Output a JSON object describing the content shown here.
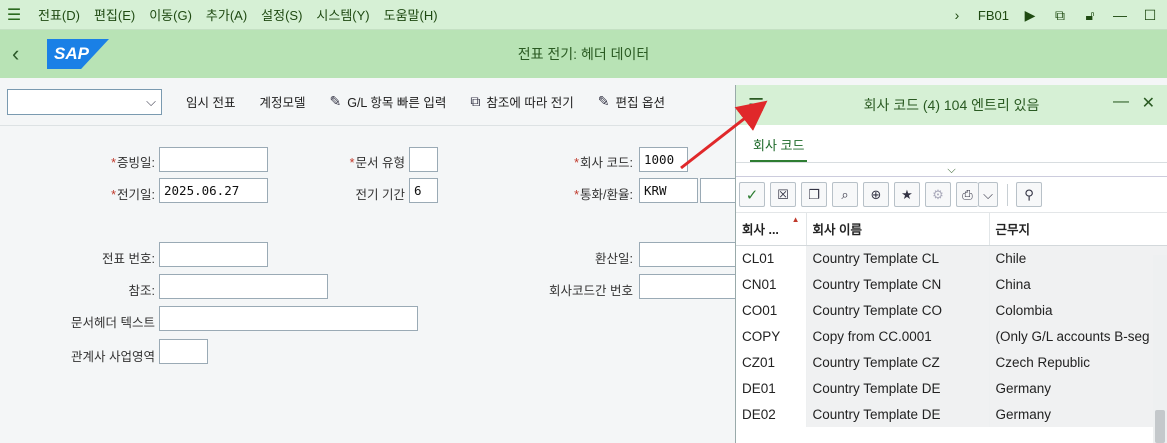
{
  "menu": {
    "items": [
      "전표(D)",
      "편집(E)",
      "이동(G)",
      "추가(A)",
      "설정(S)",
      "시스템(Y)",
      "도움말(H)"
    ],
    "tcode": "FB01"
  },
  "header": {
    "title": "전표 전기: 헤더 데이터",
    "logo": "SAP"
  },
  "toolbar": {
    "items": [
      "임시 전표",
      "계정모델",
      "G/L 항목 빠른 입력",
      "참조에 따라 전기",
      "편집 옵션"
    ]
  },
  "form": {
    "doc_date_label": "증빙일:",
    "doc_date_value": "",
    "post_date_label": "전기일:",
    "post_date_value": "2025.06.27",
    "doc_type_label": "문서 유형",
    "doc_type_value": "",
    "period_label": "전기 기간",
    "period_value": "6",
    "company_code_label": "회사 코드:",
    "company_code_value": "1000",
    "currency_label": "통화/환율:",
    "currency_value": "KRW",
    "doc_number_label": "전표 번호:",
    "translation_date_label": "환산일:",
    "reference_label": "참조:",
    "intercompany_label": "회사코드간 번호",
    "header_text_label": "문서헤더 텍스트",
    "partner_ba_label": "관계사 사업영역"
  },
  "popup": {
    "title": "회사 코드 (4)  104 엔트리 있음",
    "tab": "회사 코드",
    "columns": [
      "회사 ...",
      "회사 이름",
      "근무지"
    ],
    "rows": [
      {
        "code": "CL01",
        "name": "Country Template CL",
        "city": "Chile"
      },
      {
        "code": "CN01",
        "name": "Country Template CN",
        "city": "China"
      },
      {
        "code": "CO01",
        "name": "Country Template CO",
        "city": "Colombia"
      },
      {
        "code": "COPY",
        "name": "Copy from CC.0001",
        "city": "(Only G/L accounts B-seg"
      },
      {
        "code": "CZ01",
        "name": "Country Template CZ",
        "city": "Czech Republic"
      },
      {
        "code": "DE01",
        "name": "Country Template DE",
        "city": "Germany"
      },
      {
        "code": "DE02",
        "name": "Country Template DE",
        "city": "Germany"
      }
    ]
  },
  "colors": {
    "header_green": "#b8e3b5",
    "menubar_green": "#d6f0d5",
    "arrow_red": "#e0282a"
  }
}
